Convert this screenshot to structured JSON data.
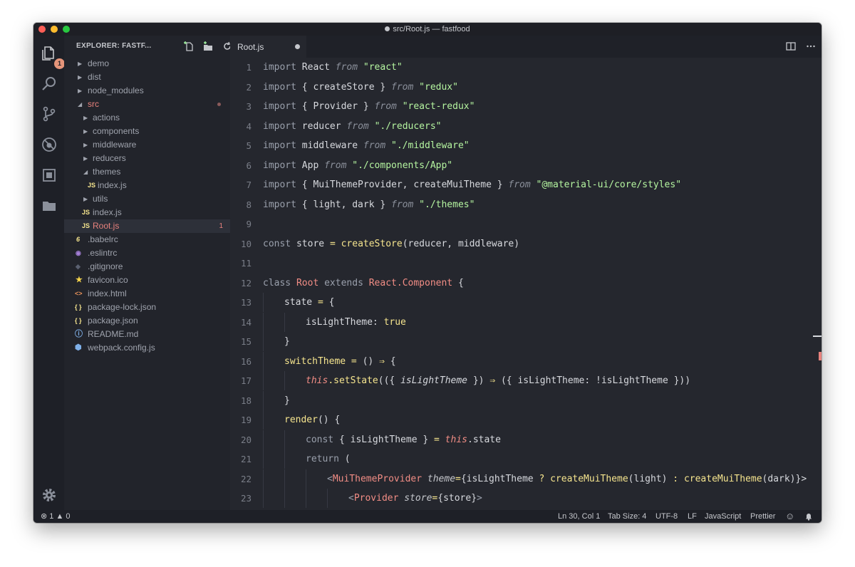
{
  "window": {
    "title": "src/Root.js — fastfood"
  },
  "activity": {
    "explorer_badge": "1"
  },
  "sidebar": {
    "title": "EXPLORER: FASTF...",
    "items": [
      {
        "label": "demo"
      },
      {
        "label": "dist"
      },
      {
        "label": "node_modules"
      },
      {
        "label": "src"
      },
      {
        "label": "actions"
      },
      {
        "label": "components"
      },
      {
        "label": "middleware"
      },
      {
        "label": "reducers"
      },
      {
        "label": "themes"
      },
      {
        "label": "index.js",
        "icon": "JS"
      },
      {
        "label": "utils"
      },
      {
        "label": "index.js",
        "icon": "JS"
      },
      {
        "label": "Root.js",
        "icon": "JS",
        "badge": "1"
      },
      {
        "label": ".babelrc"
      },
      {
        "label": ".eslintrc"
      },
      {
        "label": ".gitignore"
      },
      {
        "label": "favicon.ico"
      },
      {
        "label": "index.html"
      },
      {
        "label": "package-lock.json",
        "icon": "{ }"
      },
      {
        "label": "package.json",
        "icon": "{ }"
      },
      {
        "label": "README.md"
      },
      {
        "label": "webpack.config.js"
      }
    ]
  },
  "editor": {
    "tab_label": "Root.js",
    "line_numbers": [
      "1",
      "2",
      "3",
      "4",
      "5",
      "6",
      "7",
      "8",
      "9",
      "10",
      "11",
      "12",
      "13",
      "14",
      "15",
      "16",
      "17",
      "18",
      "19",
      "20",
      "21",
      "22",
      "23"
    ],
    "tokens": {
      "import": "import",
      "from": "from",
      "l1_a": " React ",
      "l1_s": "\"react\"",
      "l2_a": " { createStore } ",
      "l2_s": "\"redux\"",
      "l3_a": " { Provider } ",
      "l3_s": "\"react-redux\"",
      "l4_a": " reducer ",
      "l4_s": "\"./reducers\"",
      "l5_a": " middleware ",
      "l5_s": "\"./middleware\"",
      "l6_a": " App ",
      "l6_s": "\"./components/App\"",
      "l7_a": " { MuiThemeProvider, createMuiTheme } ",
      "l7_s": "\"@material-ui/core/styles\"",
      "l8_a": " { light, dark } ",
      "l8_s": "\"./themes\"",
      "l10_const": "const",
      "l10_store": " store ",
      "l10_eq": "=",
      "l10_fn": " createStore",
      "l10_args": "(reducer, middleware)",
      "l12_class": "class",
      "l12_root": " Root ",
      "l12_extends": "extends",
      "l12_react": " React.Component",
      "l12_brace": " {",
      "l13_state": "state",
      "l13_eq": " = ",
      "l13_brace": "{",
      "l14_key": "isLightTheme: ",
      "l14_true": "true",
      "l15_close": "}",
      "l16_fn": "switchTheme",
      "l16_eq": " = ",
      "l16_paren": "() ",
      "l16_arrow": "⇒",
      "l16_brace": " {",
      "l17_this": "this",
      "l17_set": ".setState",
      "l17_open": "(({ ",
      "l17_param": "isLightTheme",
      "l17_close": " }) ",
      "l17_arrow": "⇒",
      "l17_rest": " ({ isLightTheme: !isLightTheme }))",
      "l18_close": "}",
      "l19_render": "render",
      "l19_rest": "() {",
      "l20_const": "const",
      "l20_mid": " { isLightTheme } ",
      "l20_eq": "=",
      "l20_this": " this",
      "l20_state": ".state",
      "l21_return": "return",
      "l21_paren": " (",
      "l22_lt": "<",
      "l22_tag": "MuiThemeProvider",
      "l22_attr": " theme",
      "l22_eq": "=",
      "l22_open": "{isLightTheme ",
      "l22_q": "?",
      "l22_fn1": " createMuiTheme",
      "l22_a1": "(light) ",
      "l22_colon": ":",
      "l22_fn2": " createMuiTheme",
      "l22_a2": "(dark)",
      "l22_end": "}>",
      "l23_lt": "<",
      "l23_tag": "Provider",
      "l23_attr": " store",
      "l23_eq": "=",
      "l23_val": "{store}",
      "l23_gt": ">"
    }
  },
  "statusbar": {
    "errors": "1",
    "warnings": "0",
    "position": "Ln 30, Col 1",
    "tab_size": "Tab Size: 4",
    "encoding": "UTF-8",
    "eol": "LF",
    "language": "JavaScript",
    "formatter": "Prettier"
  },
  "colors": {
    "accent_badge": "#e5957a",
    "string": "#b5f5a0",
    "function": "#f6e58e",
    "class": "#f28d85",
    "background": "#25272e"
  }
}
